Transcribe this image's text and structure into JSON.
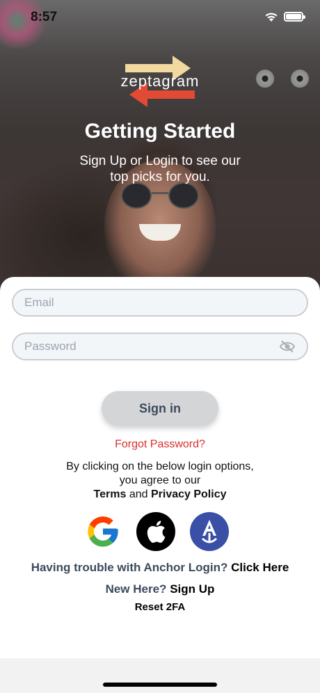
{
  "status_bar": {
    "time": "8:57"
  },
  "hero": {
    "logo_text": "zeptagram",
    "title": "Getting Started",
    "subtitle": "Sign Up or Login to see our top picks for you."
  },
  "form": {
    "email_placeholder": "Email",
    "password_placeholder": "Password",
    "signin_label": "Sign in",
    "forgot_label": "Forgot Password?"
  },
  "agreement": {
    "line1": "By clicking on the below login options,",
    "line2": "you agree to our",
    "terms": "Terms",
    "and": "and",
    "privacy": "Privacy Policy"
  },
  "social": {
    "icons": [
      "google-icon",
      "apple-icon",
      "anchor-icon"
    ]
  },
  "footer_links": {
    "trouble_text": "Having trouble with Anchor Login?",
    "click_here": "Click Here",
    "new_here": "New Here?",
    "sign_up": "Sign Up",
    "reset_2fa": "Reset 2FA"
  },
  "colors": {
    "accent_red": "#d9302c",
    "button_gray": "#d4d5d7",
    "anchor_blue": "#3a4fa6",
    "muted_text": "#3c4a5c"
  }
}
